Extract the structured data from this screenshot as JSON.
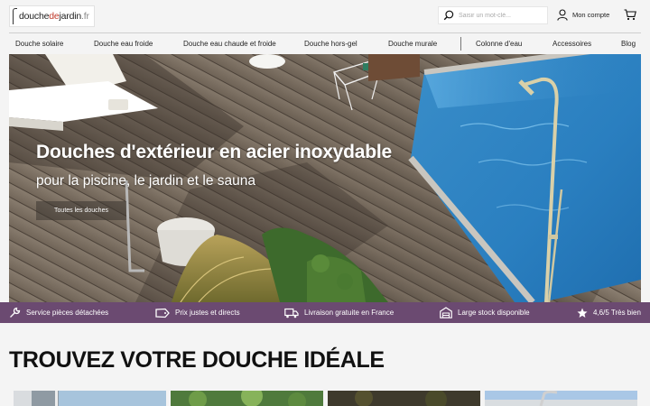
{
  "header": {
    "logo": {
      "part1": "douche",
      "part2": "de",
      "part3": "jardin",
      "part4": ".fr"
    },
    "search": {
      "placeholder": "Saisir un mot-clé..."
    },
    "account_label": "Mon compte",
    "icons": {
      "search": "search-icon",
      "account": "user-icon",
      "cart": "cart-icon"
    }
  },
  "nav": {
    "items": [
      {
        "label": "Douche solaire"
      },
      {
        "label": "Douche eau froide"
      },
      {
        "label": "Douche eau chaude et froide"
      },
      {
        "label": "Douche hors-gel"
      },
      {
        "label": "Douche murale"
      },
      {
        "label": "Colonne d'eau"
      },
      {
        "label": "Accessoires"
      },
      {
        "label": "Blog"
      }
    ]
  },
  "hero": {
    "title": "Douches d'extérieur en acier inoxydable",
    "subtitle": "pour la piscine, le jardin et le sauna",
    "button_label": "Toutes les douches"
  },
  "benefits": {
    "color": "#6b4a71",
    "items": [
      {
        "icon": "wrench-icon",
        "label": "Service pièces détachées"
      },
      {
        "icon": "tag-icon",
        "label": "Prix justes et directs"
      },
      {
        "icon": "truck-icon",
        "label": "Livraison gratuite en France"
      },
      {
        "icon": "warehouse-icon",
        "label": "Large stock disponible"
      },
      {
        "icon": "star-icon",
        "label": "4,6/5 Très bien"
      }
    ]
  },
  "section": {
    "title": "TROUVEZ VOTRE DOUCHE IDÉALE"
  }
}
